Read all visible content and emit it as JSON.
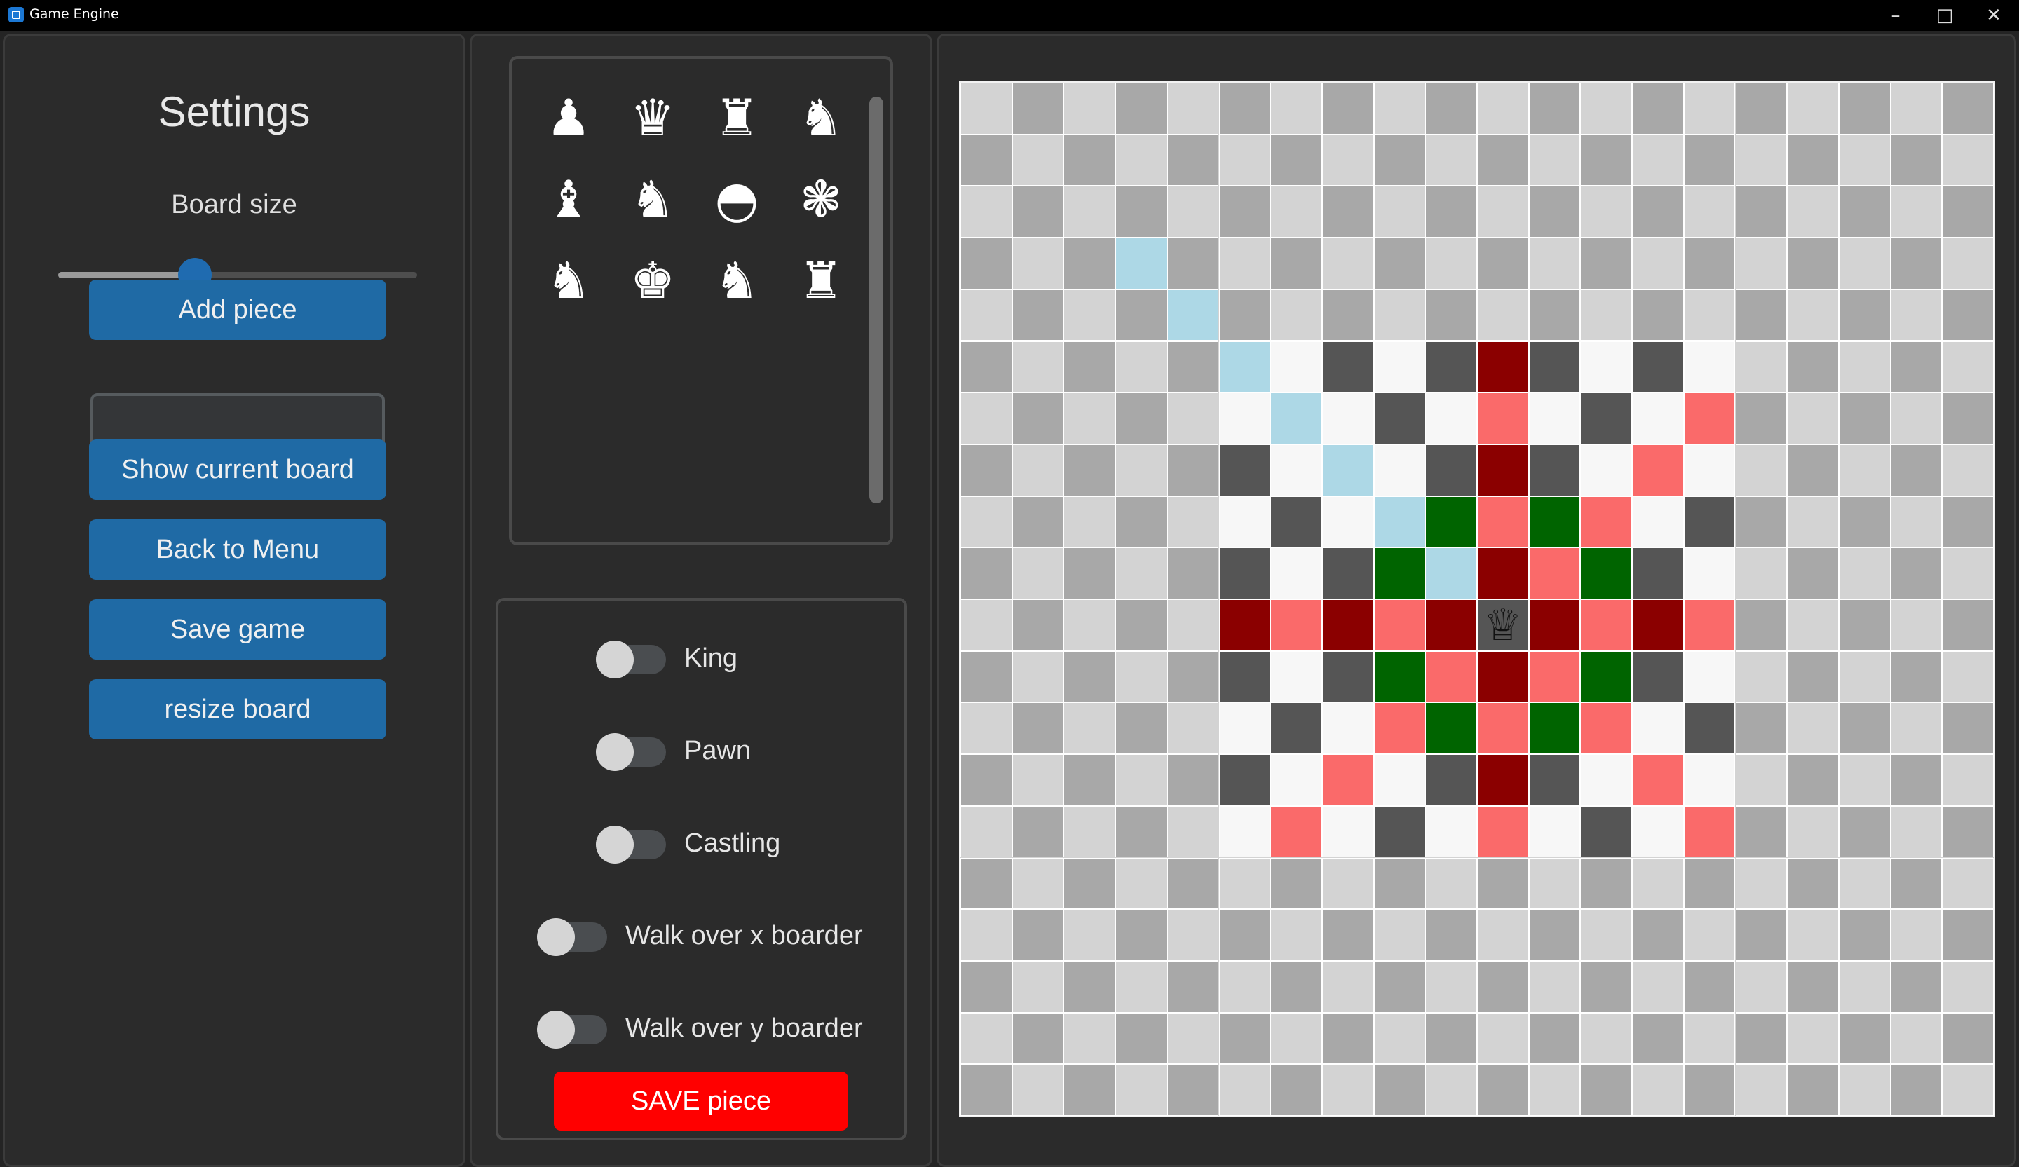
{
  "window": {
    "title": "Game Engine",
    "controls": {
      "minimize": "–",
      "maximize": "□",
      "close": "✕"
    }
  },
  "settings": {
    "title": "Settings",
    "board_size_label": "Board size",
    "board_size_fraction": 0.38,
    "buttons": [
      {
        "key": "add-piece",
        "label": "Add piece"
      },
      {
        "key": "show-current-board",
        "label": "Show current board"
      },
      {
        "key": "back-to-menu",
        "label": "Back to Menu"
      },
      {
        "key": "save-game",
        "label": "Save game"
      },
      {
        "key": "resize-board",
        "label": "resize board"
      }
    ],
    "name_entry": {
      "value": "",
      "placeholder": ""
    }
  },
  "pieces": [
    {
      "name": "pawn",
      "glyph": "♟"
    },
    {
      "name": "queen",
      "glyph": "♛"
    },
    {
      "name": "rook",
      "glyph": "♜"
    },
    {
      "name": "unicorn",
      "glyph": "♞"
    },
    {
      "name": "bishop",
      "glyph": "♝"
    },
    {
      "name": "knight-crowned",
      "glyph": "♞"
    },
    {
      "name": "checker-king",
      "glyph": "◓"
    },
    {
      "name": "elephant",
      "glyph": "❃"
    },
    {
      "name": "giraffe",
      "glyph": "♞"
    },
    {
      "name": "king",
      "glyph": "♚"
    },
    {
      "name": "knight",
      "glyph": "♞"
    },
    {
      "name": "tower",
      "glyph": "♜"
    }
  ],
  "switches": [
    {
      "key": "king",
      "label": "King",
      "on": false
    },
    {
      "key": "pawn",
      "label": "Pawn",
      "on": false
    },
    {
      "key": "castling",
      "label": "Castling",
      "on": false
    },
    {
      "key": "walk-over-x",
      "label": "Walk over x boarder",
      "on": false
    },
    {
      "key": "walk-over-y",
      "label": "Walk over y boarder",
      "on": false
    }
  ],
  "save_piece_label": "SAVE piece",
  "board": {
    "size": 20,
    "colors": {
      "outer_light": "#d3d3d3",
      "outer_dark": "#a8a8a8",
      "inner_light": "#f7f7f7",
      "inner_dark": "#555555",
      "blue": "#add8e6",
      "green": "#006400",
      "dark_red": "#8b0000",
      "light_red": "#fa6a6a"
    },
    "active_region": {
      "col_start": 5,
      "col_end": 14,
      "row_start": 5,
      "row_end": 14
    },
    "highlights": [
      {
        "row": 3,
        "col": 3,
        "type": "blue"
      },
      {
        "row": 4,
        "col": 4,
        "type": "blue"
      },
      {
        "row": 5,
        "col": 5,
        "type": "blue"
      },
      {
        "row": 6,
        "col": 6,
        "type": "blue"
      },
      {
        "row": 7,
        "col": 7,
        "type": "blue"
      },
      {
        "row": 8,
        "col": 8,
        "type": "blue"
      },
      {
        "row": 9,
        "col": 9,
        "type": "blue"
      },
      {
        "row": 5,
        "col": 10,
        "type": "dark_red"
      },
      {
        "row": 6,
        "col": 10,
        "type": "light_red"
      },
      {
        "row": 7,
        "col": 10,
        "type": "dark_red"
      },
      {
        "row": 8,
        "col": 10,
        "type": "light_red"
      },
      {
        "row": 9,
        "col": 10,
        "type": "dark_red"
      },
      {
        "row": 11,
        "col": 10,
        "type": "dark_red"
      },
      {
        "row": 12,
        "col": 10,
        "type": "light_red"
      },
      {
        "row": 13,
        "col": 10,
        "type": "dark_red"
      },
      {
        "row": 14,
        "col": 10,
        "type": "light_red"
      },
      {
        "row": 10,
        "col": 5,
        "type": "dark_red"
      },
      {
        "row": 10,
        "col": 6,
        "type": "light_red"
      },
      {
        "row": 10,
        "col": 7,
        "type": "dark_red"
      },
      {
        "row": 10,
        "col": 8,
        "type": "light_red"
      },
      {
        "row": 10,
        "col": 9,
        "type": "dark_red"
      },
      {
        "row": 10,
        "col": 11,
        "type": "dark_red"
      },
      {
        "row": 10,
        "col": 12,
        "type": "light_red"
      },
      {
        "row": 10,
        "col": 13,
        "type": "dark_red"
      },
      {
        "row": 10,
        "col": 14,
        "type": "light_red"
      },
      {
        "row": 6,
        "col": 14,
        "type": "light_red"
      },
      {
        "row": 7,
        "col": 13,
        "type": "light_red"
      },
      {
        "row": 8,
        "col": 12,
        "type": "light_red"
      },
      {
        "row": 8,
        "col": 11,
        "type": "green"
      },
      {
        "row": 8,
        "col": 9,
        "type": "green"
      },
      {
        "row": 9,
        "col": 8,
        "type": "green"
      },
      {
        "row": 9,
        "col": 11,
        "type": "light_red"
      },
      {
        "row": 9,
        "col": 12,
        "type": "green"
      },
      {
        "row": 11,
        "col": 8,
        "type": "green"
      },
      {
        "row": 11,
        "col": 9,
        "type": "light_red"
      },
      {
        "row": 11,
        "col": 11,
        "type": "light_red"
      },
      {
        "row": 11,
        "col": 12,
        "type": "green"
      },
      {
        "row": 12,
        "col": 8,
        "type": "light_red"
      },
      {
        "row": 12,
        "col": 9,
        "type": "green"
      },
      {
        "row": 12,
        "col": 11,
        "type": "green"
      },
      {
        "row": 12,
        "col": 12,
        "type": "light_red"
      },
      {
        "row": 13,
        "col": 7,
        "type": "light_red"
      },
      {
        "row": 13,
        "col": 13,
        "type": "light_red"
      },
      {
        "row": 14,
        "col": 6,
        "type": "light_red"
      },
      {
        "row": 14,
        "col": 14,
        "type": "light_red"
      }
    ],
    "pieces_on_board": [
      {
        "row": 10,
        "col": 10,
        "name": "queen",
        "glyph": "♕"
      }
    ]
  }
}
